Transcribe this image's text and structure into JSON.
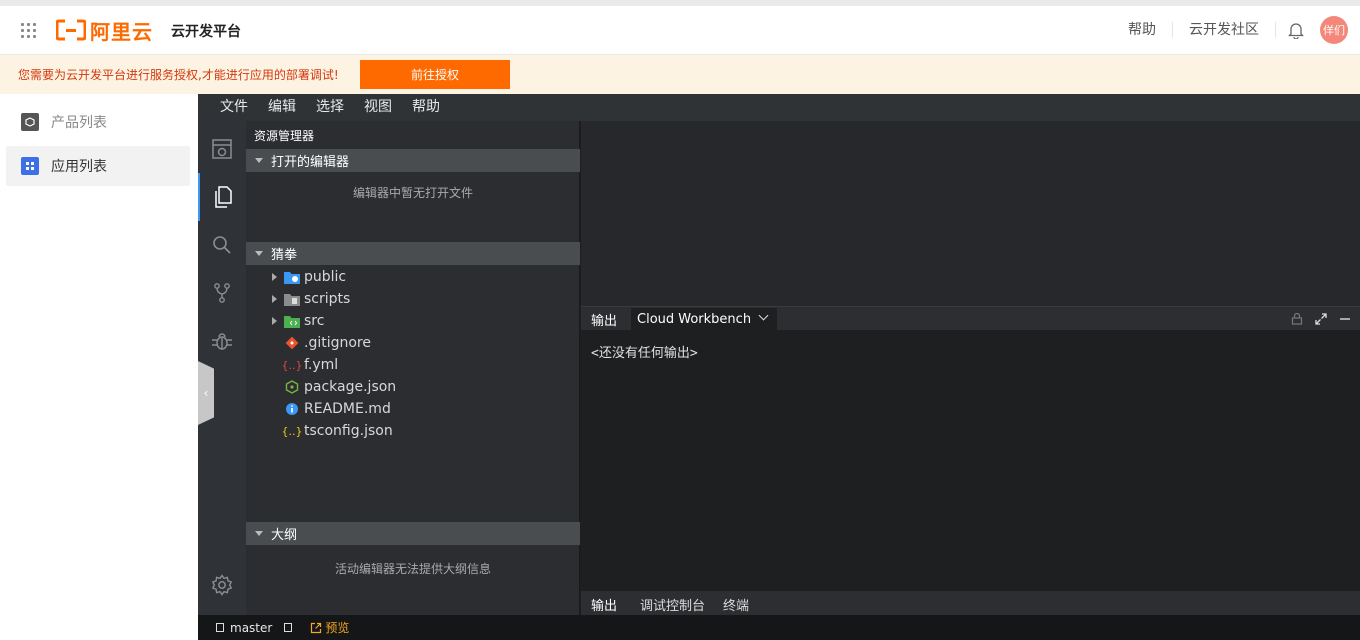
{
  "header": {
    "logo_text": "阿里云",
    "platform_title": "云开发平台",
    "links": [
      "帮助",
      "云开发社区"
    ],
    "avatar_text": "佯们",
    "brand_color": "#ff6a00"
  },
  "notice": {
    "message": "您需要为云开发平台进行服务授权,才能进行应用的部署调试!",
    "button_label": "前往授权"
  },
  "left_nav": {
    "items": [
      {
        "label": "产品列表",
        "icon": "cube-icon"
      },
      {
        "label": "应用列表",
        "icon": "apps-grid-icon",
        "active": true
      }
    ]
  },
  "ide": {
    "menu": [
      "文件",
      "编辑",
      "选择",
      "视图",
      "帮助"
    ],
    "activity_icons": [
      "cloud-console-icon",
      "files-icon",
      "search-icon",
      "source-control-icon",
      "debug-icon",
      "settings-icon"
    ],
    "explorer": {
      "title": "资源管理器",
      "open_editors": {
        "label": "打开的编辑器",
        "empty_message": "编辑器中暂无打开文件"
      },
      "project": {
        "label": "猜拳",
        "items": [
          {
            "name": "public",
            "type": "folder",
            "icon_color": "#3b97f3"
          },
          {
            "name": "scripts",
            "type": "folder",
            "icon_color": "#8c8c8c"
          },
          {
            "name": "src",
            "type": "folder",
            "icon_color": "#4caf50"
          },
          {
            "name": ".gitignore",
            "type": "file",
            "icon": "git-icon",
            "icon_color": "#e8552d"
          },
          {
            "name": "f.yml",
            "type": "file",
            "icon": "braces-icon",
            "icon_color": "#e04848"
          },
          {
            "name": "package.json",
            "type": "file",
            "icon": "node-icon",
            "icon_color": "#7cb342"
          },
          {
            "name": "README.md",
            "type": "file",
            "icon": "info-icon",
            "icon_color": "#3b97f3"
          },
          {
            "name": "tsconfig.json",
            "type": "file",
            "icon": "braces-icon",
            "icon_color": "#f5c518"
          }
        ]
      },
      "outline": {
        "label": "大纲",
        "empty_message": "活动编辑器无法提供大纲信息"
      }
    },
    "panel": {
      "tab_label": "输出",
      "channel": "Cloud Workbench",
      "output": "<还没有任何输出>",
      "bottom_tabs": [
        "输出",
        "调试控制台",
        "终端"
      ]
    },
    "statusbar": {
      "branch": "master",
      "preview": "预览"
    }
  }
}
